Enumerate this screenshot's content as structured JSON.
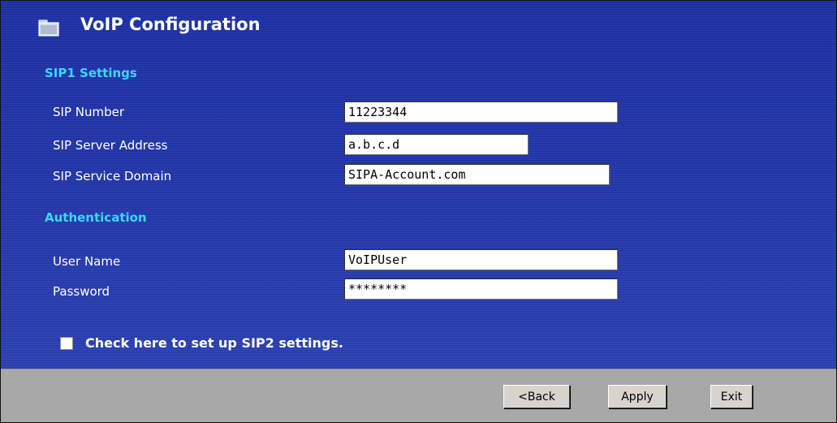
{
  "header": {
    "title": "VoIP Configuration",
    "icon": "folder-icon"
  },
  "sip1": {
    "section_title": "SIP1   Settings",
    "fields": [
      {
        "label": "SIP Number",
        "value": "11223344"
      },
      {
        "label": "SIP Server Address",
        "value": "a.b.c.d"
      },
      {
        "label": "SIP Service Domain",
        "value": "SIPA-Account.com"
      }
    ]
  },
  "auth": {
    "section_title": "Authentication",
    "fields": [
      {
        "label": "User Name",
        "value": "VoIPUser"
      },
      {
        "label": "Password",
        "value": "********"
      }
    ]
  },
  "sip2_checkbox": {
    "label": "Check here to set up SIP2 settings.",
    "checked": false
  },
  "buttons": {
    "back": "<Back",
    "apply": "Apply",
    "exit": "Exit"
  },
  "colors": {
    "panel_blue": "#1d2e9c",
    "section_cyan": "#3ad6ff",
    "footer_gray": "#a8a8a8"
  }
}
